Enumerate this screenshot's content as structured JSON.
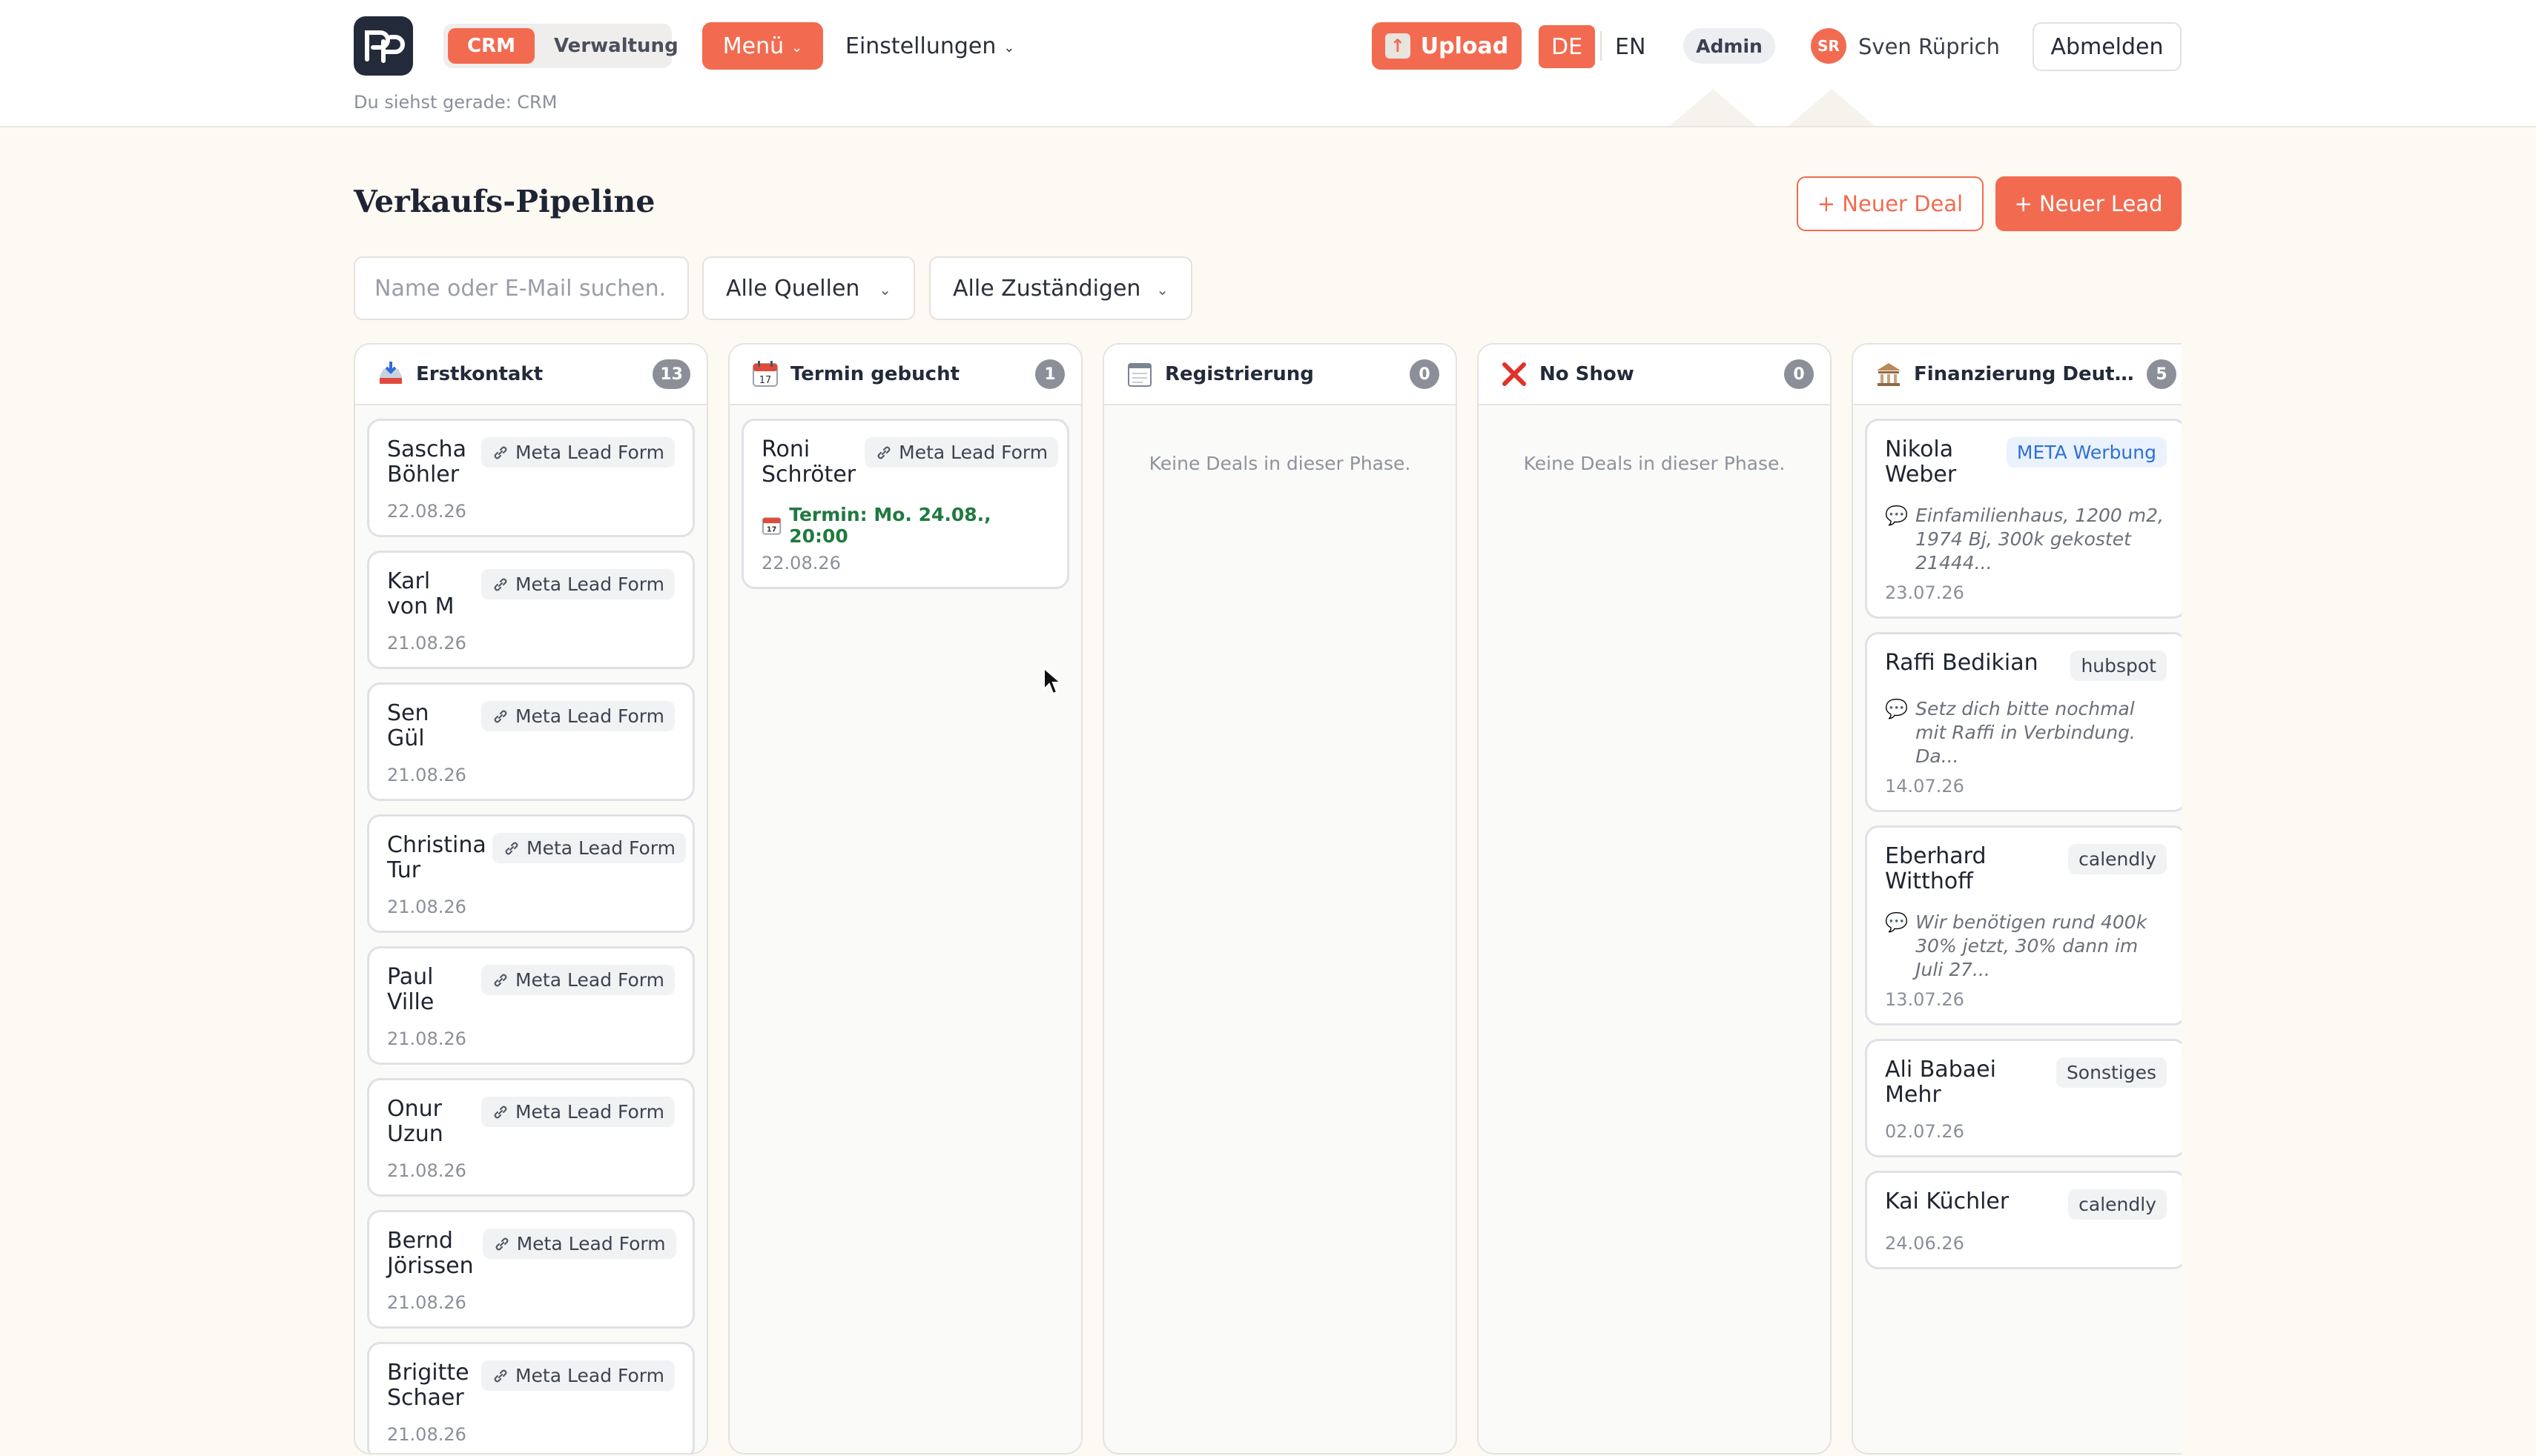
{
  "topbar": {
    "segments": [
      "CRM",
      "Verwaltung"
    ],
    "active_segment": "CRM",
    "menu_label": "Menü",
    "settings_label": "Einstellungen",
    "upload_label": "Upload",
    "lang_active": "DE",
    "lang_other": "EN",
    "role_badge": "Admin",
    "avatar_initials": "SR",
    "user_name": "Sven Rüprich",
    "logout_label": "Abmelden",
    "viewing_text": "Du siehst gerade: CRM"
  },
  "header": {
    "title": "Verkaufs-Pipeline",
    "new_deal_label": "+ Neuer Deal",
    "new_lead_label": "+ Neuer Lead"
  },
  "filters": {
    "search_placeholder": "Name oder E-Mail suchen...",
    "sources_label": "Alle Quellen",
    "owners_label": "Alle Zuständigen"
  },
  "columns": [
    {
      "title": "Erstkontakt",
      "icon": "inbox-tray-icon",
      "count": "13",
      "cards": [
        {
          "name": "Sascha Böhler",
          "tag": "Meta Lead Form",
          "date": "22.08.26"
        },
        {
          "name": "Karl von M",
          "tag": "Meta Lead Form",
          "date": "21.08.26"
        },
        {
          "name": "Sen Gül",
          "tag": "Meta Lead Form",
          "date": "21.08.26"
        },
        {
          "name": "Christina Tur",
          "tag": "Meta Lead Form",
          "date": "21.08.26"
        },
        {
          "name": "Paul Ville",
          "tag": "Meta Lead Form",
          "date": "21.08.26"
        },
        {
          "name": "Onur Uzun",
          "tag": "Meta Lead Form",
          "date": "21.08.26"
        },
        {
          "name": "Bernd Jörissen",
          "tag": "Meta Lead Form",
          "date": "21.08.26"
        },
        {
          "name": "Brigitte Schaer",
          "tag": "Meta Lead Form",
          "date": "21.08.26"
        }
      ]
    },
    {
      "title": "Termin gebucht",
      "icon": "calendar-icon",
      "count": "1",
      "cards": [
        {
          "name": "Roni Schröter",
          "tag": "Meta Lead Form",
          "termin": "Termin: Mo. 24.08., 20:00",
          "date": "22.08.26"
        }
      ]
    },
    {
      "title": "Registrierung",
      "icon": "notepad-icon",
      "count": "0",
      "empty_text": "Keine Deals in dieser Phase.",
      "cards": []
    },
    {
      "title": "No Show",
      "icon": "red-x-icon",
      "count": "0",
      "empty_text": "Keine Deals in dieser Phase.",
      "cards": []
    },
    {
      "title": "Finanzierung Deutschland",
      "icon": "bank-icon",
      "count": "5",
      "cards": [
        {
          "name": "Nikola Weber",
          "tag": "META Werbung",
          "note": "Einfamilienhaus, 1200 m2, 1974 Bj, 300k gekostet 21444...",
          "date": "23.07.26"
        },
        {
          "name": "Raffi Bedikian",
          "tag": "hubspot",
          "note": "Setz dich bitte nochmal mit Raffi in Verbindung. Da...",
          "date": "14.07.26"
        },
        {
          "name": "Eberhard Witthoff",
          "tag": "calendly",
          "note": "Wir benötigen rund 400k 30% jetzt, 30% dann im Juli 27...",
          "date": "13.07.26"
        },
        {
          "name": "Ali Babaei Mehr",
          "tag": "Sonstiges",
          "date": "02.07.26"
        },
        {
          "name": "Kai Küchler",
          "tag": "calendly",
          "date": "24.06.26"
        }
      ]
    }
  ],
  "colors": {
    "accent": "#f26b50",
    "background": "#fdf9f3",
    "termin_green": "#207a3e",
    "meta_blue": "#2f6fd8"
  }
}
